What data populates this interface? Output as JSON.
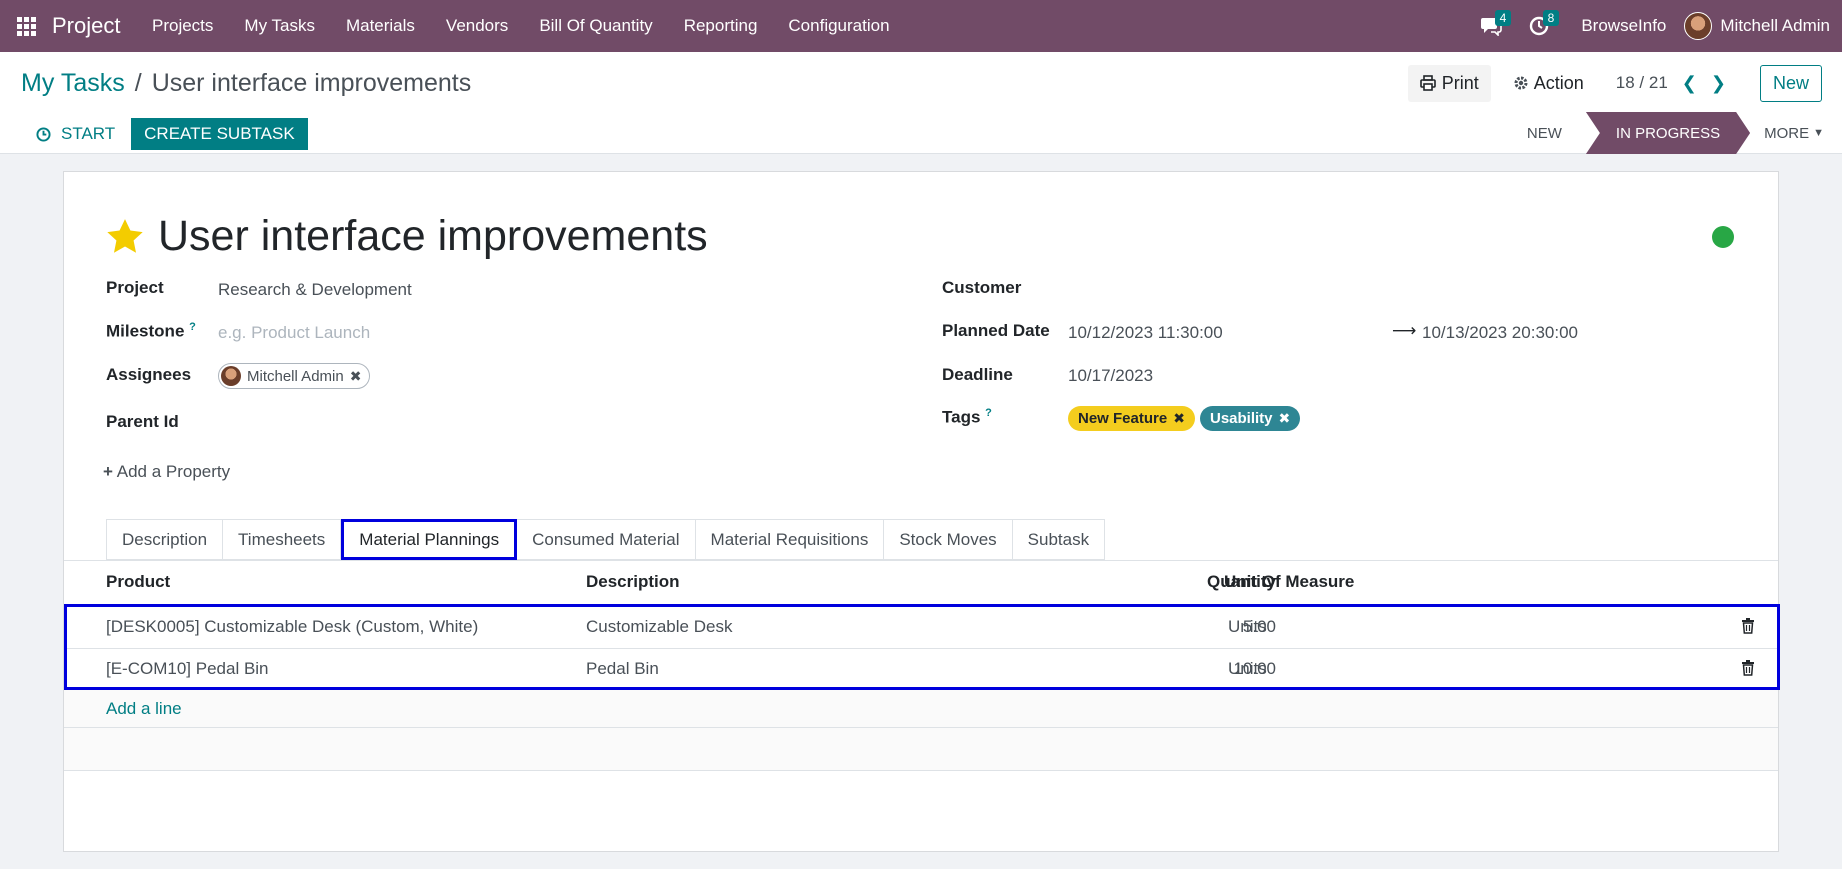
{
  "navbar": {
    "app_name": "Project",
    "menu": [
      "Projects",
      "My Tasks",
      "Materials",
      "Vendors",
      "Bill Of Quantity",
      "Reporting",
      "Configuration"
    ],
    "messages_count": "4",
    "activities_count": "8",
    "company": "BrowseInfo",
    "user": "Mitchell Admin"
  },
  "breadcrumb": {
    "parent": "My Tasks",
    "separator": "/",
    "current": "User interface improvements"
  },
  "controls": {
    "print_label": "Print",
    "action_label": "Action",
    "pager": "18 / 21",
    "new_label": "New"
  },
  "statusbar": {
    "start_label": "START",
    "create_subtask_label": "CREATE SUBTASK",
    "stages": [
      "NEW",
      "IN PROGRESS"
    ],
    "active_stage": "IN PROGRESS",
    "more_label": "MORE"
  },
  "task": {
    "title": "User interface improvements",
    "starred": true,
    "status_color": "#28a745",
    "left_fields": {
      "project_label": "Project",
      "project_value": "Research & Development",
      "milestone_label": "Milestone",
      "milestone_placeholder": "e.g. Product Launch",
      "assignees_label": "Assignees",
      "assignee": "Mitchell Admin",
      "parent_label": "Parent Id"
    },
    "right_fields": {
      "customer_label": "Customer",
      "planned_label": "Planned Date",
      "planned_start": "10/12/2023 11:30:00",
      "planned_end": "10/13/2023 20:30:00",
      "deadline_label": "Deadline",
      "deadline_value": "10/17/2023",
      "tags_label": "Tags",
      "tags": [
        {
          "name": "New Feature",
          "color": "#f4cd1e"
        },
        {
          "name": "Usability",
          "color": "#2e8694"
        }
      ]
    },
    "help_mark": "?",
    "add_property_label": "Add a Property"
  },
  "tabs": [
    "Description",
    "Timesheets",
    "Material Plannings",
    "Consumed Material",
    "Material Requisitions",
    "Stock Moves",
    "Subtask"
  ],
  "active_tab": "Material Plannings",
  "material_table": {
    "columns": [
      "Product",
      "Description",
      "Quantity",
      "Unit Of Measure"
    ],
    "rows": [
      {
        "product": "[DESK0005] Customizable Desk (Custom, White)",
        "description": "Customizable Desk",
        "quantity": "5.00",
        "uom": "Units"
      },
      {
        "product": "[E-COM10] Pedal Bin",
        "description": "Pedal Bin",
        "quantity": "10.00",
        "uom": "Units"
      }
    ],
    "add_line_label": "Add a line"
  }
}
